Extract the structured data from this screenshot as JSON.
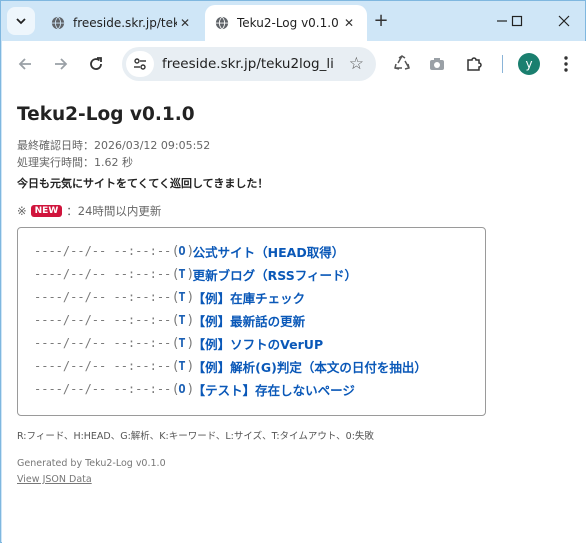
{
  "browser": {
    "tabs": [
      {
        "title": "freeside.skr.jp/tek",
        "active": false
      },
      {
        "title": "Teku2-Log v0.1.0",
        "active": true
      }
    ],
    "url": "freeside.skr.jp/teku2log_li...",
    "profile_initial": "y"
  },
  "page": {
    "title": "Teku2-Log v0.1.0",
    "last_checked": "最終確認日時：2026/03/12 09:05:52",
    "exec_time": "処理実行時間：1.62 秒",
    "greeting": "今日も元気にサイトをてくてく巡回してきました！",
    "legend_prefix": "※",
    "new_badge": "NEW",
    "legend_text": "：24時間以内更新",
    "entries": [
      {
        "timestamp": "----/--/-- --:--:--",
        "open": "(",
        "code": "O",
        "close": ")",
        "label": "公式サイト（HEAD取得）"
      },
      {
        "timestamp": "----/--/-- --:--:--",
        "open": "(",
        "code": "T",
        "close": ")",
        "label": "更新ブログ（RSSフィード）"
      },
      {
        "timestamp": "----/--/-- --:--:--",
        "open": "(",
        "code": "T",
        "close": ")",
        "label": "【例】在庫チェック"
      },
      {
        "timestamp": "----/--/-- --:--:--",
        "open": "(",
        "code": "T",
        "close": ")",
        "label": "【例】最新話の更新"
      },
      {
        "timestamp": "----/--/-- --:--:--",
        "open": "(",
        "code": "T",
        "close": ")",
        "label": "【例】ソフトのVerUP"
      },
      {
        "timestamp": "----/--/-- --:--:--",
        "open": "(",
        "code": "T",
        "close": ")",
        "label": "【例】解析(G)判定（本文の日付を抽出）"
      },
      {
        "timestamp": "----/--/-- --:--:--",
        "open": "(",
        "code": "O",
        "close": ")",
        "label": "【テスト】存在しないページ"
      }
    ],
    "key_legend": "R:フィード、H:HEAD、G:解析、K:キーワード、L:サイズ、T:タイムアウト、0:失敗",
    "generated_by": "Generated by Teku2-Log v0.1.0",
    "json_link": "View JSON Data"
  },
  "colors": {
    "accent_link": "#0a58b8",
    "new_badge": "#d0143c",
    "tabstrip": "#cfe6f7"
  }
}
